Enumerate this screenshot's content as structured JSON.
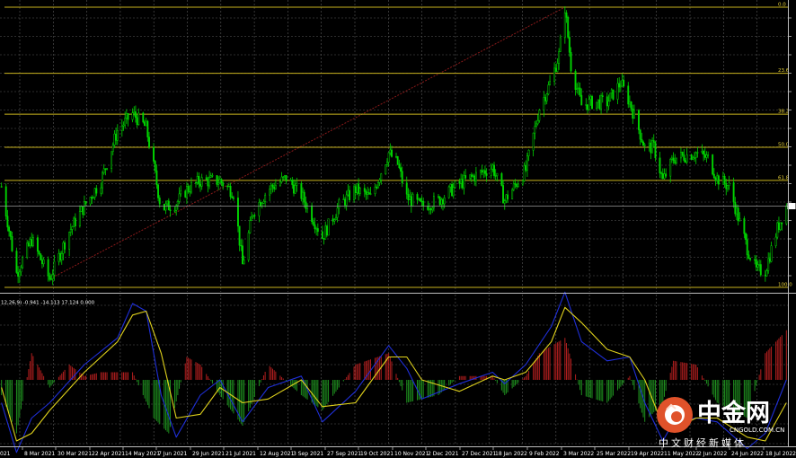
{
  "chart_data": [
    {
      "type": "candlestick",
      "title": "",
      "x_tick_labels": [
        "8 Mar 2021",
        "30 Mar 2021",
        "22 Apr 2021",
        "14 May 2021",
        "7 Jun 2021",
        "29 Jun 2021",
        "21 Jul 2021",
        "12 Aug 2021",
        "3 Sep 2021",
        "27 Sep 2021",
        "19 Oct 2021",
        "10 Nov 2021",
        "2 Dec 2021",
        "27 Dec 2021",
        "18 Jan 2022",
        "9 Feb 2022",
        "3 Mar 2022",
        "25 Mar 2022",
        "19 Apr 2022",
        "11 May 2022",
        "2 Jun 2022",
        "24 Jun 2022",
        "18 Jul 2022"
      ],
      "x_tick_partial": "021",
      "price_path": [
        {
          "date": "2021-02-26",
          "price": 0.36
        },
        {
          "date": "2021-03-08",
          "price": 0.05
        },
        {
          "date": "2021-03-18",
          "price": 0.17
        },
        {
          "date": "2021-03-30",
          "price": 0.03
        },
        {
          "date": "2021-04-12",
          "price": 0.2
        },
        {
          "date": "2021-04-22",
          "price": 0.29
        },
        {
          "date": "2021-05-03",
          "price": 0.38
        },
        {
          "date": "2021-05-14",
          "price": 0.56
        },
        {
          "date": "2021-05-24",
          "price": 0.62
        },
        {
          "date": "2021-06-02",
          "price": 0.57
        },
        {
          "date": "2021-06-07",
          "price": 0.43
        },
        {
          "date": "2021-06-12",
          "price": 0.28
        },
        {
          "date": "2021-06-22",
          "price": 0.3
        },
        {
          "date": "2021-06-29",
          "price": 0.35
        },
        {
          "date": "2021-07-08",
          "price": 0.38
        },
        {
          "date": "2021-07-21",
          "price": 0.38
        },
        {
          "date": "2021-07-30",
          "price": 0.34
        },
        {
          "date": "2021-08-05",
          "price": 0.08
        },
        {
          "date": "2021-08-12",
          "price": 0.27
        },
        {
          "date": "2021-08-22",
          "price": 0.35
        },
        {
          "date": "2021-09-03",
          "price": 0.39
        },
        {
          "date": "2021-09-13",
          "price": 0.33
        },
        {
          "date": "2021-09-27",
          "price": 0.18
        },
        {
          "date": "2021-10-08",
          "price": 0.29
        },
        {
          "date": "2021-10-19",
          "price": 0.35
        },
        {
          "date": "2021-10-29",
          "price": 0.32
        },
        {
          "date": "2021-11-10",
          "price": 0.48
        },
        {
          "date": "2021-11-16",
          "price": 0.44
        },
        {
          "date": "2021-11-22",
          "price": 0.32
        },
        {
          "date": "2021-12-02",
          "price": 0.29
        },
        {
          "date": "2021-12-13",
          "price": 0.31
        },
        {
          "date": "2021-12-27",
          "price": 0.37
        },
        {
          "date": "2022-01-07",
          "price": 0.4
        },
        {
          "date": "2022-01-18",
          "price": 0.43
        },
        {
          "date": "2022-01-26",
          "price": 0.31
        },
        {
          "date": "2022-02-09",
          "price": 0.42
        },
        {
          "date": "2022-02-18",
          "price": 0.64
        },
        {
          "date": "2022-02-26",
          "price": 0.74
        },
        {
          "date": "2022-03-03",
          "price": 0.83
        },
        {
          "date": "2022-03-07",
          "price": 1.0
        },
        {
          "date": "2022-03-11",
          "price": 0.79
        },
        {
          "date": "2022-03-18",
          "price": 0.65
        },
        {
          "date": "2022-03-25",
          "price": 0.66
        },
        {
          "date": "2022-04-04",
          "price": 0.66
        },
        {
          "date": "2022-04-13",
          "price": 0.73
        },
        {
          "date": "2022-04-19",
          "price": 0.66
        },
        {
          "date": "2022-04-29",
          "price": 0.5
        },
        {
          "date": "2022-05-05",
          "price": 0.5
        },
        {
          "date": "2022-05-11",
          "price": 0.38
        },
        {
          "date": "2022-05-18",
          "price": 0.46
        },
        {
          "date": "2022-06-02",
          "price": 0.48
        },
        {
          "date": "2022-06-10",
          "price": 0.46
        },
        {
          "date": "2022-06-16",
          "price": 0.39
        },
        {
          "date": "2022-06-24",
          "price": 0.36
        },
        {
          "date": "2022-07-06",
          "price": 0.14
        },
        {
          "date": "2022-07-12",
          "price": 0.06
        },
        {
          "date": "2022-07-18",
          "price": 0.06
        },
        {
          "date": "2022-07-26",
          "price": 0.21
        },
        {
          "date": "2022-08-01",
          "price": 0.29
        }
      ],
      "fibonacci_levels": [
        {
          "label": "0.0",
          "level": 0.0
        },
        {
          "label": "23.6",
          "level": 23.6
        },
        {
          "label": "38.2",
          "level": 38.2
        },
        {
          "label": "50.0",
          "level": 50.0
        },
        {
          "label": "61.8",
          "level": 61.8
        },
        {
          "label": "100.0",
          "level": 100.0
        }
      ],
      "grid": true,
      "colors": {
        "candles": "#00d400",
        "fibonacci": "#c8b21e",
        "trendline": "#8b1a1a",
        "background": "#000000",
        "grid": "#5a5a5a",
        "current_price": "#9a9a9a"
      }
    },
    {
      "type": "macd",
      "label_text": "12,26,9) -0.941 -14.113 17.124 0.000",
      "histogram_path": [
        {
          "date": "2021-02-26",
          "value": -0.2
        },
        {
          "date": "2021-03-08",
          "value": -0.7
        },
        {
          "date": "2021-03-18",
          "value": 0.35
        },
        {
          "date": "2021-03-30",
          "value": -0.1
        },
        {
          "date": "2021-04-12",
          "value": 0.2
        },
        {
          "date": "2021-04-22",
          "value": 0.05
        },
        {
          "date": "2021-05-03",
          "value": 0.1
        },
        {
          "date": "2021-05-14",
          "value": 0.1
        },
        {
          "date": "2021-05-24",
          "value": 0.1
        },
        {
          "date": "2021-06-07",
          "value": -0.5
        },
        {
          "date": "2021-06-17",
          "value": -0.7
        },
        {
          "date": "2021-06-29",
          "value": 0.3
        },
        {
          "date": "2021-07-08",
          "value": 0.2
        },
        {
          "date": "2021-07-21",
          "value": -0.2
        },
        {
          "date": "2021-08-05",
          "value": -0.6
        },
        {
          "date": "2021-08-22",
          "value": 0.2
        },
        {
          "date": "2021-09-13",
          "value": -0.2
        },
        {
          "date": "2021-09-27",
          "value": -0.4
        },
        {
          "date": "2021-10-19",
          "value": 0.2
        },
        {
          "date": "2021-11-10",
          "value": 0.35
        },
        {
          "date": "2021-11-22",
          "value": -0.3
        },
        {
          "date": "2021-12-13",
          "value": -0.2
        },
        {
          "date": "2021-12-27",
          "value": 0.05
        },
        {
          "date": "2022-01-18",
          "value": 0.05
        },
        {
          "date": "2022-01-26",
          "value": -0.2
        },
        {
          "date": "2022-02-09",
          "value": 0.05
        },
        {
          "date": "2022-02-18",
          "value": 0.35
        },
        {
          "date": "2022-03-07",
          "value": 0.55
        },
        {
          "date": "2022-03-18",
          "value": -0.2
        },
        {
          "date": "2022-04-04",
          "value": -0.3
        },
        {
          "date": "2022-04-19",
          "value": 0.05
        },
        {
          "date": "2022-04-29",
          "value": -0.55
        },
        {
          "date": "2022-05-11",
          "value": -0.3
        },
        {
          "date": "2022-05-18",
          "value": 0.25
        },
        {
          "date": "2022-06-02",
          "value": 0.2
        },
        {
          "date": "2022-06-16",
          "value": -0.3
        },
        {
          "date": "2022-07-06",
          "value": -0.5
        },
        {
          "date": "2022-07-18",
          "value": 0.35
        },
        {
          "date": "2022-08-01",
          "value": 0.65
        }
      ],
      "main_line_path": [
        {
          "date": "2021-02-26",
          "value": -0.3
        },
        {
          "date": "2021-03-08",
          "value": -0.95
        },
        {
          "date": "2021-03-18",
          "value": -0.5
        },
        {
          "date": "2021-03-30",
          "value": -0.3
        },
        {
          "date": "2021-04-22",
          "value": 0.2
        },
        {
          "date": "2021-05-14",
          "value": 0.55
        },
        {
          "date": "2021-05-24",
          "value": 1.0
        },
        {
          "date": "2021-06-02",
          "value": 0.9
        },
        {
          "date": "2021-06-12",
          "value": -0.2
        },
        {
          "date": "2021-06-22",
          "value": -0.75
        },
        {
          "date": "2021-07-08",
          "value": -0.2
        },
        {
          "date": "2021-07-21",
          "value": 0.0
        },
        {
          "date": "2021-08-05",
          "value": -0.55
        },
        {
          "date": "2021-08-22",
          "value": -0.1
        },
        {
          "date": "2021-09-13",
          "value": 0.05
        },
        {
          "date": "2021-09-27",
          "value": -0.55
        },
        {
          "date": "2021-10-19",
          "value": -0.15
        },
        {
          "date": "2021-11-10",
          "value": 0.45
        },
        {
          "date": "2021-11-22",
          "value": 0.15
        },
        {
          "date": "2021-12-02",
          "value": -0.25
        },
        {
          "date": "2021-12-27",
          "value": -0.05
        },
        {
          "date": "2022-01-18",
          "value": 0.1
        },
        {
          "date": "2022-01-26",
          "value": -0.05
        },
        {
          "date": "2022-02-09",
          "value": 0.2
        },
        {
          "date": "2022-02-26",
          "value": 0.7
        },
        {
          "date": "2022-03-07",
          "value": 1.15
        },
        {
          "date": "2022-03-18",
          "value": 0.5
        },
        {
          "date": "2022-04-04",
          "value": 0.25
        },
        {
          "date": "2022-04-19",
          "value": 0.3
        },
        {
          "date": "2022-04-29",
          "value": -0.3
        },
        {
          "date": "2022-05-11",
          "value": -0.8
        },
        {
          "date": "2022-05-18",
          "value": -0.55
        },
        {
          "date": "2022-06-02",
          "value": -0.5
        },
        {
          "date": "2022-06-16",
          "value": -0.55
        },
        {
          "date": "2022-07-06",
          "value": -0.9
        },
        {
          "date": "2022-07-18",
          "value": -0.7
        },
        {
          "date": "2022-08-01",
          "value": 0.0
        }
      ],
      "signal_line_path": [
        {
          "date": "2021-02-26",
          "value": -0.1
        },
        {
          "date": "2021-03-08",
          "value": -0.8
        },
        {
          "date": "2021-03-18",
          "value": -0.7
        },
        {
          "date": "2021-03-30",
          "value": -0.4
        },
        {
          "date": "2021-04-22",
          "value": 0.1
        },
        {
          "date": "2021-05-14",
          "value": 0.5
        },
        {
          "date": "2021-05-24",
          "value": 0.85
        },
        {
          "date": "2021-06-02",
          "value": 0.9
        },
        {
          "date": "2021-06-12",
          "value": 0.35
        },
        {
          "date": "2021-06-22",
          "value": -0.5
        },
        {
          "date": "2021-07-08",
          "value": -0.45
        },
        {
          "date": "2021-07-21",
          "value": -0.1
        },
        {
          "date": "2021-08-05",
          "value": -0.3
        },
        {
          "date": "2021-08-22",
          "value": -0.25
        },
        {
          "date": "2021-09-13",
          "value": 0.0
        },
        {
          "date": "2021-09-27",
          "value": -0.35
        },
        {
          "date": "2021-10-19",
          "value": -0.3
        },
        {
          "date": "2021-11-10",
          "value": 0.3
        },
        {
          "date": "2021-11-22",
          "value": 0.3
        },
        {
          "date": "2021-12-02",
          "value": 0.0
        },
        {
          "date": "2021-12-27",
          "value": -0.15
        },
        {
          "date": "2022-01-18",
          "value": 0.05
        },
        {
          "date": "2022-01-26",
          "value": 0.0
        },
        {
          "date": "2022-02-09",
          "value": 0.1
        },
        {
          "date": "2022-02-26",
          "value": 0.5
        },
        {
          "date": "2022-03-07",
          "value": 0.95
        },
        {
          "date": "2022-03-18",
          "value": 0.75
        },
        {
          "date": "2022-04-04",
          "value": 0.4
        },
        {
          "date": "2022-04-19",
          "value": 0.3
        },
        {
          "date": "2022-04-29",
          "value": 0.0
        },
        {
          "date": "2022-05-11",
          "value": -0.6
        },
        {
          "date": "2022-05-18",
          "value": -0.65
        },
        {
          "date": "2022-06-02",
          "value": -0.5
        },
        {
          "date": "2022-06-16",
          "value": -0.5
        },
        {
          "date": "2022-07-06",
          "value": -0.75
        },
        {
          "date": "2022-07-18",
          "value": -0.8
        },
        {
          "date": "2022-08-01",
          "value": -0.3
        }
      ],
      "colors": {
        "histogram_positive": "#b01e1e",
        "histogram_negative": "#1e8f1e",
        "main_line": "#1f2fd8",
        "signal_line": "#e0d21c"
      }
    }
  ],
  "watermark": {
    "logo_text": "中金网",
    "domain_text": "CNGOLD.COM.CN",
    "tagline": "中文财经新媒体",
    "logo_color": "#e0522a"
  }
}
